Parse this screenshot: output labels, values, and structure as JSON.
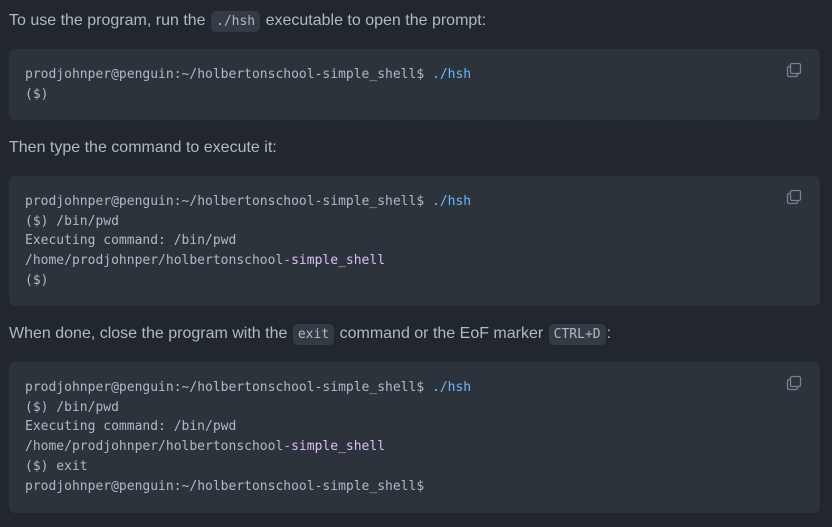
{
  "paragraphs": {
    "p1": {
      "before": "To use the program, run the ",
      "code": "./hsh",
      "after": " executable to open the prompt:"
    },
    "p2": {
      "text": "Then type the command to execute it:"
    },
    "p3": {
      "before": "When done, close the program with the ",
      "code1": "exit",
      "middle": " command or the EoF marker ",
      "code2": "CTRL+D",
      "after": ":"
    }
  },
  "blocks": {
    "b1": {
      "lines": [
        {
          "user": "prodjohnper",
          "at": "@",
          "host": "penguin:~/holbertonschool-simple_shell$",
          "cmd": " ./hsh"
        },
        {
          "plain": "($)"
        }
      ],
      "copy_icon": "copy-icon"
    },
    "b2": {
      "lines": [
        {
          "user": "prodjohnper",
          "at": "@",
          "host": "penguin:~/holbertonschool-simple_shell$",
          "cmd": " ./hsh"
        },
        {
          "plain": "($) /bin/pwd"
        },
        {
          "plain": "Executing command: /bin/pwd"
        },
        {
          "path_a": "/home/prodjohnper/holbertonschool-",
          "path_b": "simple_shell"
        },
        {
          "plain": "($)"
        }
      ],
      "copy_icon": "copy-icon"
    },
    "b3": {
      "lines": [
        {
          "user": "prodjohnper",
          "at": "@",
          "host": "penguin:~/holbertonschool-simple_shell$",
          "cmd": " ./hsh"
        },
        {
          "plain": "($) /bin/pwd"
        },
        {
          "plain": "Executing command: /bin/pwd"
        },
        {
          "path_a": "/home/prodjohnper/holbertonschool-",
          "path_b": "simple_shell"
        },
        {
          "plain": "($) exit"
        },
        {
          "user": "prodjohnper",
          "at": "@",
          "host": "penguin:~/holbertonschool-simple_shell$",
          "cmd": ""
        }
      ],
      "copy_icon": "copy-icon"
    }
  },
  "colors": {
    "background": "#22272e",
    "code_background": "#2d333b",
    "text": "#adbac7",
    "accent_blue": "#6cb6ff",
    "accent_purple": "#dcbdfb"
  }
}
